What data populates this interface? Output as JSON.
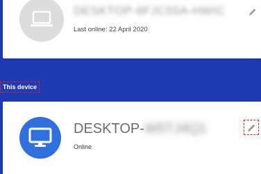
{
  "devices": [
    {
      "name": "DESKTOP-8FJC55A-HWIC",
      "status": "Last online: 22 April 2020",
      "icon": "laptop-icon",
      "edit_icon": "pencil-icon"
    },
    {
      "name_visible": "DESKTOP-",
      "name_hidden": "W5TJ4Q1",
      "status": "Online",
      "icon": "monitor-icon",
      "edit_icon": "pencil-icon"
    }
  ],
  "section": {
    "this_device_label": "This device"
  },
  "colors": {
    "background": "#1f3bb3",
    "avatar_active": "#2f6fe0",
    "avatar_inactive": "#dcdcdc",
    "highlight": "#e02020"
  }
}
